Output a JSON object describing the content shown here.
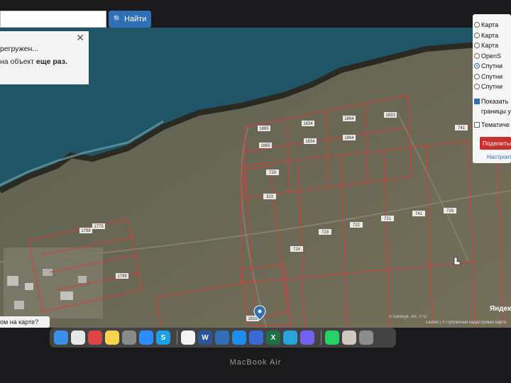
{
  "search": {
    "button_label": "Найти",
    "button_icon": "search-icon",
    "placeholder": ""
  },
  "notice": {
    "line1": "регружен...",
    "line2_prefix": "на объект ",
    "line2_bold": "еще раз.",
    "close": "✕"
  },
  "layers": {
    "items": [
      {
        "label": "Карта",
        "checked": false
      },
      {
        "label": "Карта",
        "checked": false
      },
      {
        "label": "Карта",
        "checked": false
      },
      {
        "label": "OpenS",
        "checked": false
      },
      {
        "label": "Спутни",
        "checked": true
      },
      {
        "label": "Спутни",
        "checked": false
      },
      {
        "label": "Спутни",
        "checked": false
      }
    ],
    "show_borders_line1": "Показать",
    "show_borders_line2": "границы у",
    "thematic": "Тематиче",
    "show_button": "Поделитьс",
    "settings_link": "Настроить"
  },
  "bottom_question": "ом на карте?",
  "attribution": "© GeoEye, Inc. © О",
  "attribution2": "Leaflet | © Публичная кадастровая карта",
  "yandex": "Яндек",
  "parcel_labels": [
    "1865",
    "1834",
    "1864",
    "1833",
    "1865",
    "1834",
    "1864",
    "741",
    "729",
    "724",
    "723",
    "722",
    "721",
    "741",
    "729",
    "323",
    "754",
    "1799",
    "1798",
    "1775",
    "1816"
  ],
  "dock": {
    "icons": [
      "finder-icon",
      "chrome-icon",
      "launchpad-icon",
      "notes-icon",
      "settings-icon",
      "zoom-icon",
      "skype-icon",
      "textedit-icon",
      "word-icon",
      "tasks-icon",
      "appstore-icon",
      "mail-icon",
      "excel-icon",
      "telegram-icon",
      "viber-icon",
      "whatsapp-icon",
      "preview-icon",
      "trash-icon"
    ],
    "word_letter": "W",
    "excel_letter": "X",
    "skype_letter": "S"
  },
  "laptop_label": "MacBook Air",
  "colors": {
    "sea": "#1f5566",
    "land": "#6c6b55",
    "parcel": "#e0383a",
    "button": "#2f6fb8",
    "show_button": "#c9302c"
  }
}
